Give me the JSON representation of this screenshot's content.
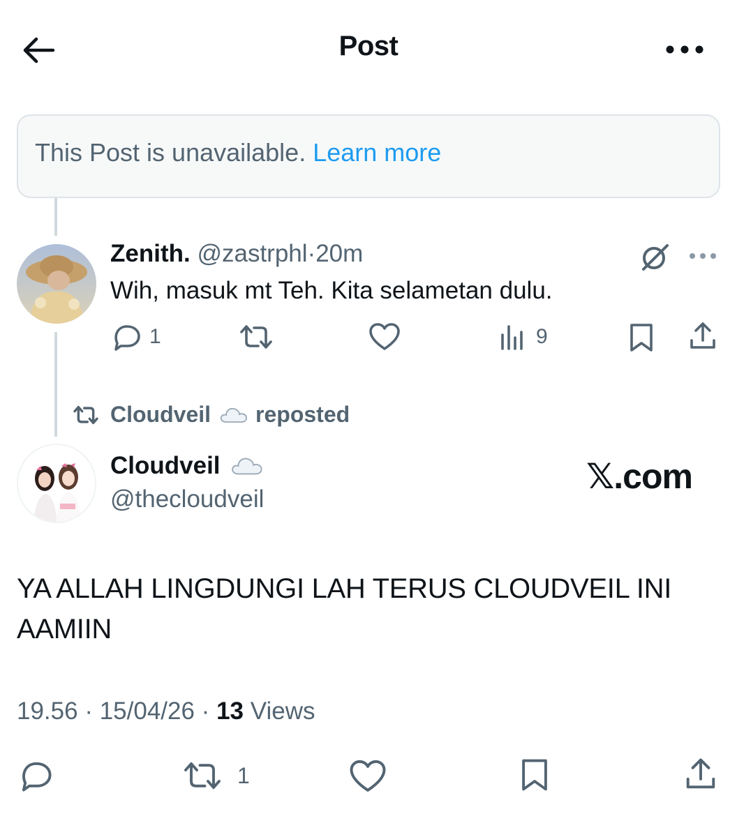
{
  "header": {
    "title": "Post"
  },
  "unavailable": {
    "text": "This Post is unavailable.",
    "link": "Learn more"
  },
  "reply": {
    "name": "Zenith.",
    "handle": "@zastrphl",
    "separator": "·",
    "time": "20m",
    "text": "Wih, masuk mt Teh. Kita selametan dulu.",
    "actions": {
      "replies": "1",
      "reposts": "",
      "likes": "",
      "views": "9"
    }
  },
  "repost_banner": {
    "name": "Cloudveil",
    "label": "reposted"
  },
  "post": {
    "name": "Cloudveil",
    "handle": "@thecloudveil",
    "watermark": "𝕏.com",
    "text": "YA ALLAH LINGDUNGI LAH TERUS CLOUDVEIL INI AAMIIN",
    "time": "19.56",
    "date": "15/04/26",
    "views_count": "13",
    "views_label": "Views",
    "actions": {
      "replies": "",
      "reposts": "1",
      "likes": ""
    }
  },
  "colors": {
    "accent": "#1d9bf0",
    "muted": "#536471",
    "text": "#0f1419",
    "line": "#cfd9de"
  },
  "icons": [
    "back-arrow-icon",
    "more-icon",
    "grok-icon",
    "reply-icon",
    "repost-icon",
    "like-icon",
    "views-icon",
    "bookmark-icon",
    "share-icon",
    "cloud-icon"
  ]
}
